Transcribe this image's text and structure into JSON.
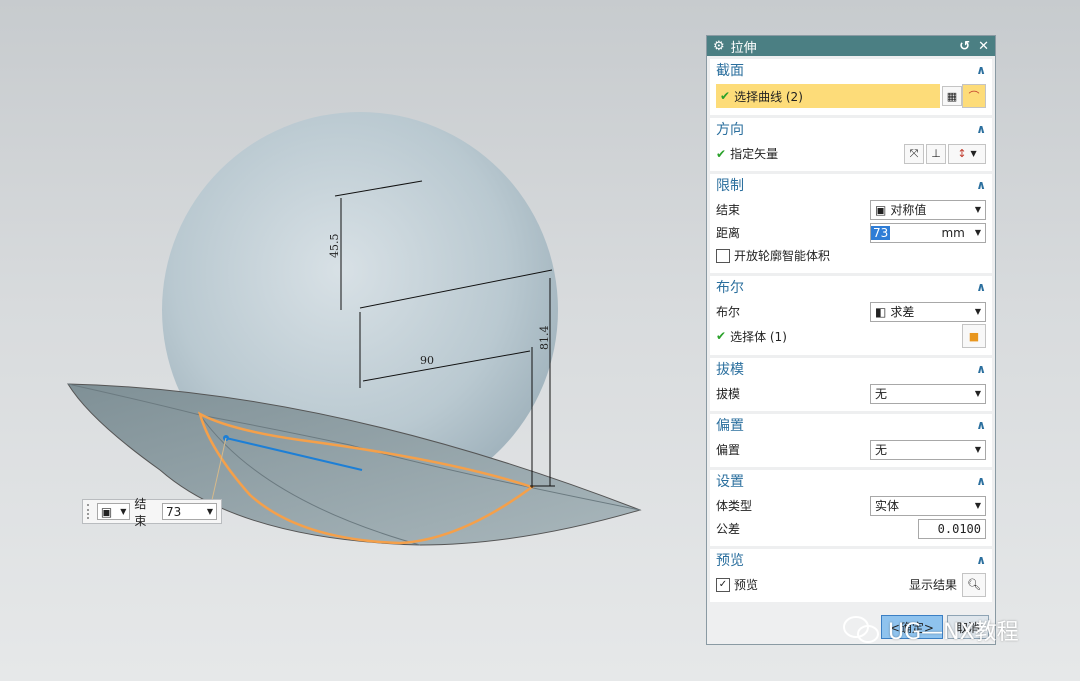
{
  "dimensions": {
    "d1": "45.5",
    "d2": "90",
    "d3": "81.4"
  },
  "float_widget": {
    "end_label": "结束",
    "end_value": "73"
  },
  "dialog": {
    "title": "拉伸",
    "sections": {
      "section": {
        "title": "截面",
        "select_curve": "选择曲线 (2)"
      },
      "direction": {
        "title": "方向",
        "specify_vector": "指定矢量"
      },
      "limits": {
        "title": "限制",
        "end_label": "结束",
        "end_value": "对称值",
        "distance_label": "距离",
        "distance_value": "73",
        "distance_unit": "mm",
        "open_profile_label": "开放轮廓智能体积"
      },
      "boolean": {
        "title": "布尔",
        "boolean_label": "布尔",
        "boolean_value": "求差",
        "select_body": "选择体 (1)"
      },
      "draft": {
        "title": "拔模",
        "draft_label": "拔模",
        "draft_value": "无"
      },
      "offset": {
        "title": "偏置",
        "offset_label": "偏置",
        "offset_value": "无"
      },
      "settings": {
        "title": "设置",
        "body_type_label": "体类型",
        "body_type_value": "实体",
        "tolerance_label": "公差",
        "tolerance_value": "0.0100"
      },
      "preview": {
        "title": "预览",
        "preview_label": "预览",
        "show_result_label": "显示结果"
      }
    },
    "buttons": {
      "ok": "<确定>",
      "cancel": "取消"
    }
  },
  "watermark": "UG—NX教程",
  "colors": {
    "titlebar": "#4b7f83",
    "section_header": "#2b6f9e",
    "highlight": "#fddc79",
    "curve": "#f5a04a",
    "vector": "#1d7fd6"
  }
}
